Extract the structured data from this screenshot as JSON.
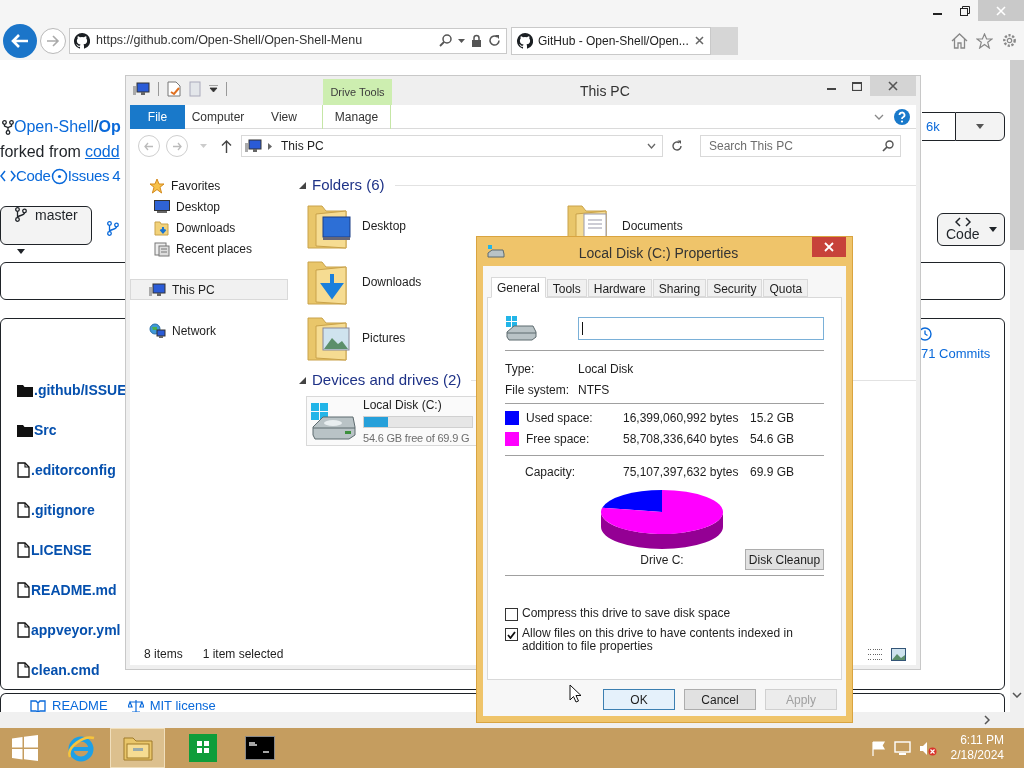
{
  "browser": {
    "url": "https://github.com/Open-Shell/Open-Shell-Menu",
    "tabs": [
      {
        "title": "GitHub - Open-Shell/Open...",
        "selected": true
      }
    ]
  },
  "github": {
    "owner": "Open-Shell",
    "separator": "/",
    "repo": "Op",
    "forked_label": "forked from",
    "forked_link": "codd",
    "nav": [
      {
        "kind": "code",
        "label": "Code"
      },
      {
        "kind": "issues",
        "label": "Issues",
        "count": "4"
      }
    ],
    "branch": "master",
    "fork_count": "6k",
    "code_button": "Code",
    "commits": "71 Commits",
    "files": [
      {
        "name": ".github/ISSUE",
        "kind": "folder"
      },
      {
        "name": "Src",
        "kind": "folder"
      },
      {
        "name": ".editorconfig",
        "kind": "file"
      },
      {
        "name": ".gitignore",
        "kind": "file"
      },
      {
        "name": "LICENSE",
        "kind": "file"
      },
      {
        "name": "README.md",
        "kind": "file"
      },
      {
        "name": "appveyor.yml",
        "kind": "file"
      },
      {
        "name": "clean.cmd",
        "kind": "file"
      }
    ],
    "footer_tabs": [
      {
        "kind": "readme",
        "label": "README"
      },
      {
        "kind": "license",
        "label": "MIT license"
      }
    ]
  },
  "explorer": {
    "title": "This PC",
    "context_tab": "Drive Tools",
    "ribbon_tabs": [
      {
        "label": "File",
        "kind": "file"
      },
      {
        "label": "Computer",
        "kind": "tab"
      },
      {
        "label": "View",
        "kind": "tab"
      },
      {
        "label": "Manage",
        "kind": "context"
      }
    ],
    "address": "This PC",
    "search": {
      "placeholder": "Search This PC"
    },
    "nav": [
      {
        "label": "Favorites",
        "kind": "favorites",
        "selected": false,
        "children": [
          {
            "label": "Desktop",
            "kind": "desktop",
            "selected": false
          },
          {
            "label": "Downloads",
            "kind": "downloads",
            "selected": false
          },
          {
            "label": "Recent places",
            "kind": "recent",
            "selected": false
          }
        ]
      },
      {
        "label": "This PC",
        "kind": "pc",
        "selected": true
      },
      {
        "label": "Network",
        "kind": "network",
        "selected": false
      }
    ],
    "groups": [
      {
        "title": "Folders (6)",
        "kind": "folders",
        "items": [
          {
            "label": "Desktop",
            "kind": "desktop"
          },
          {
            "label": "Downloads",
            "kind": "downloads"
          },
          {
            "label": "Pictures",
            "kind": "pictures"
          },
          {
            "label": "Documents",
            "kind": "documents"
          }
        ]
      },
      {
        "title": "Devices and drives (2)",
        "kind": "drives",
        "items": [
          {
            "label": "Local Disk (C:)",
            "detail": "54.6 GB free of 69.9 G",
            "level": 0.22
          }
        ]
      }
    ],
    "status": [
      "8 items",
      "1 item selected"
    ]
  },
  "dialog": {
    "title": "Local Disk (C:) Properties",
    "tabs": [
      {
        "label": "General",
        "selected": true
      },
      {
        "label": "Tools",
        "selected": false
      },
      {
        "label": "Hardware",
        "selected": false
      },
      {
        "label": "Sharing",
        "selected": false
      },
      {
        "label": "Security",
        "selected": false
      },
      {
        "label": "Quota",
        "selected": false
      }
    ],
    "type_label": "Type:",
    "type": "Local Disk",
    "fs_label": "File system:",
    "fs": "NTFS",
    "space": [
      {
        "label": "Used space:",
        "bytes": "16,399,060,992 bytes",
        "size": "15.2 GB",
        "color": "#0000ff"
      },
      {
        "label": "Free space:",
        "bytes": "58,708,336,640 bytes",
        "size": "54.6 GB",
        "color": "#ff00ff"
      }
    ],
    "capacity": {
      "label": "Capacity:",
      "bytes": "75,107,397,632 bytes",
      "size": "69.9 GB"
    },
    "drive_label": "Drive C:",
    "cleanup_button": "Disk Cleanup",
    "options": [
      {
        "label": "Compress this drive to save disk space",
        "checked": false
      },
      {
        "label": "Allow files on this drive to have contents indexed in addition to file properties",
        "checked": true
      }
    ],
    "buttons": [
      {
        "label": "OK",
        "kind": "default"
      },
      {
        "label": "Cancel",
        "kind": "normal"
      },
      {
        "label": "Apply",
        "kind": "disabled"
      }
    ]
  },
  "taskbar": {
    "apps": [
      {
        "kind": "ie",
        "selected": false
      },
      {
        "kind": "explorer",
        "selected": true
      },
      {
        "kind": "store",
        "selected": false
      },
      {
        "kind": "cmd",
        "selected": false
      }
    ],
    "time": "6:11 PM",
    "date": "2/18/2024"
  }
}
